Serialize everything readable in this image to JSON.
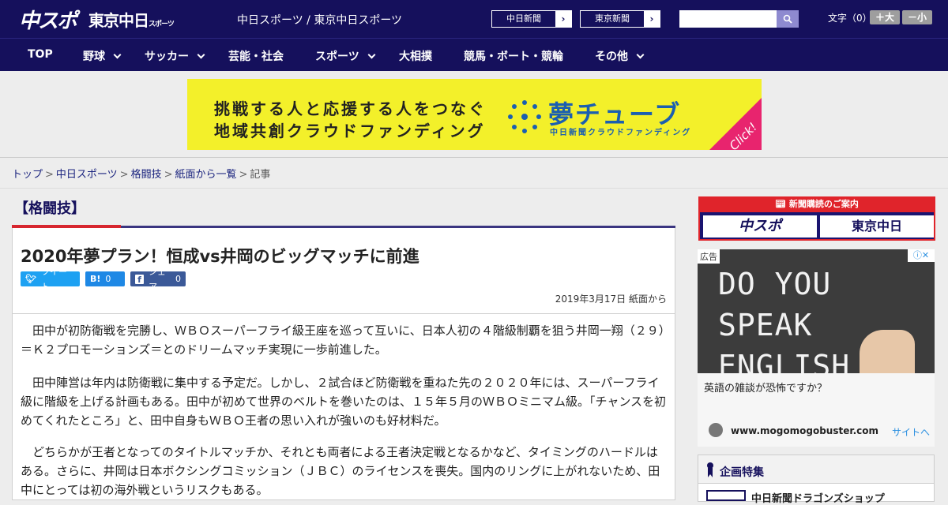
{
  "header": {
    "logo_chuspo": "中スポ",
    "logo_tokyo": "東京中日",
    "logo_tokyo_sub": "スポーツ",
    "site_title": "中日スポーツ / 東京中日スポーツ",
    "ext_links": [
      "中日新聞",
      "東京新聞"
    ],
    "moji_label": "文字（0）",
    "size_up": "＋大",
    "size_down": "－小"
  },
  "nav": {
    "items": [
      {
        "label": "TOP",
        "dropdown": false
      },
      {
        "label": "野球",
        "dropdown": true
      },
      {
        "label": "サッカー",
        "dropdown": true
      },
      {
        "label": "芸能・社会",
        "dropdown": false
      },
      {
        "label": "スポーツ",
        "dropdown": true
      },
      {
        "label": "大相撲",
        "dropdown": false
      },
      {
        "label": "競馬・ボート・競輪",
        "dropdown": false
      },
      {
        "label": "その他",
        "dropdown": true
      }
    ]
  },
  "banner": {
    "line1": "挑戦する人と応援する人をつなぐ",
    "line2": "地域共創クラウドファンディング",
    "brand": "夢チューブ",
    "brand_sub": "中日新聞クラウドファンディング",
    "click": "Click!"
  },
  "breadcrumb": [
    "トップ",
    "中日スポーツ",
    "格闘技",
    "紙面から一覧",
    "記事"
  ],
  "category": "【格闘技】",
  "article": {
    "title": "2020年夢プラン！恒成vs井岡のビッグマッチに前進",
    "share": {
      "tweet": "ツイート",
      "hatena_icon": "B!",
      "hatena_count": "0",
      "facebook": "シェア",
      "facebook_count": "0"
    },
    "date": "2019年3月17日 紙面から",
    "paragraphs": [
      "田中が初防衛戦を完勝し、ＷＢＯスーパーフライ級王座を巡って互いに、日本人初の４階級制覇を狙う井岡一翔（２９）＝Ｋ２プロモーションズ＝とのドリームマッチ実現に一歩前進した。",
      "田中陣営は年内は防衛戦に集中する予定だ。しかし、２試合ほど防衛戦を重ねた先の２０２０年には、スーパーフライ級に階級を上げる計画もある。田中が初めて世界のベルトを巻いたのは、１５年５月のＷＢＯミニマム級。「チャンスを初めてくれたところ」と、田中自身もＷＢＯ王者の思い入れが強いのも好材料だ。",
      "どちらかが王者となってのタイトルマッチか、それとも両者による王者決定戦となるかなど、タイミングのハードルはある。さらに、井岡は日本ボクシングコミッション（ＪＢＣ）のライセンスを喪失。国内のリングに上がれないため、田中にとっては初の海外戦というリスクもある。"
    ]
  },
  "sidebar": {
    "subscribe_title": "新聞購読のご案内",
    "logo1": "中スポ",
    "logo2": "東京中日",
    "ad": {
      "tag": "広告",
      "chalk_line1": "DO YOU SPEAK",
      "chalk_line2": "ENGLISH ?",
      "question": "英語の雑談が恐怖ですか？",
      "site": "www.mogomogobuster.com",
      "link": "サイトへ"
    },
    "feature_title": "企画特集",
    "feature_item": "中日新聞ドラゴンズショップ"
  },
  "colors": {
    "header_bg": "#15105c",
    "accent_red": "#d7262f",
    "banner_yellow": "#f3f02a",
    "banner_blue": "#1b5fb0"
  }
}
